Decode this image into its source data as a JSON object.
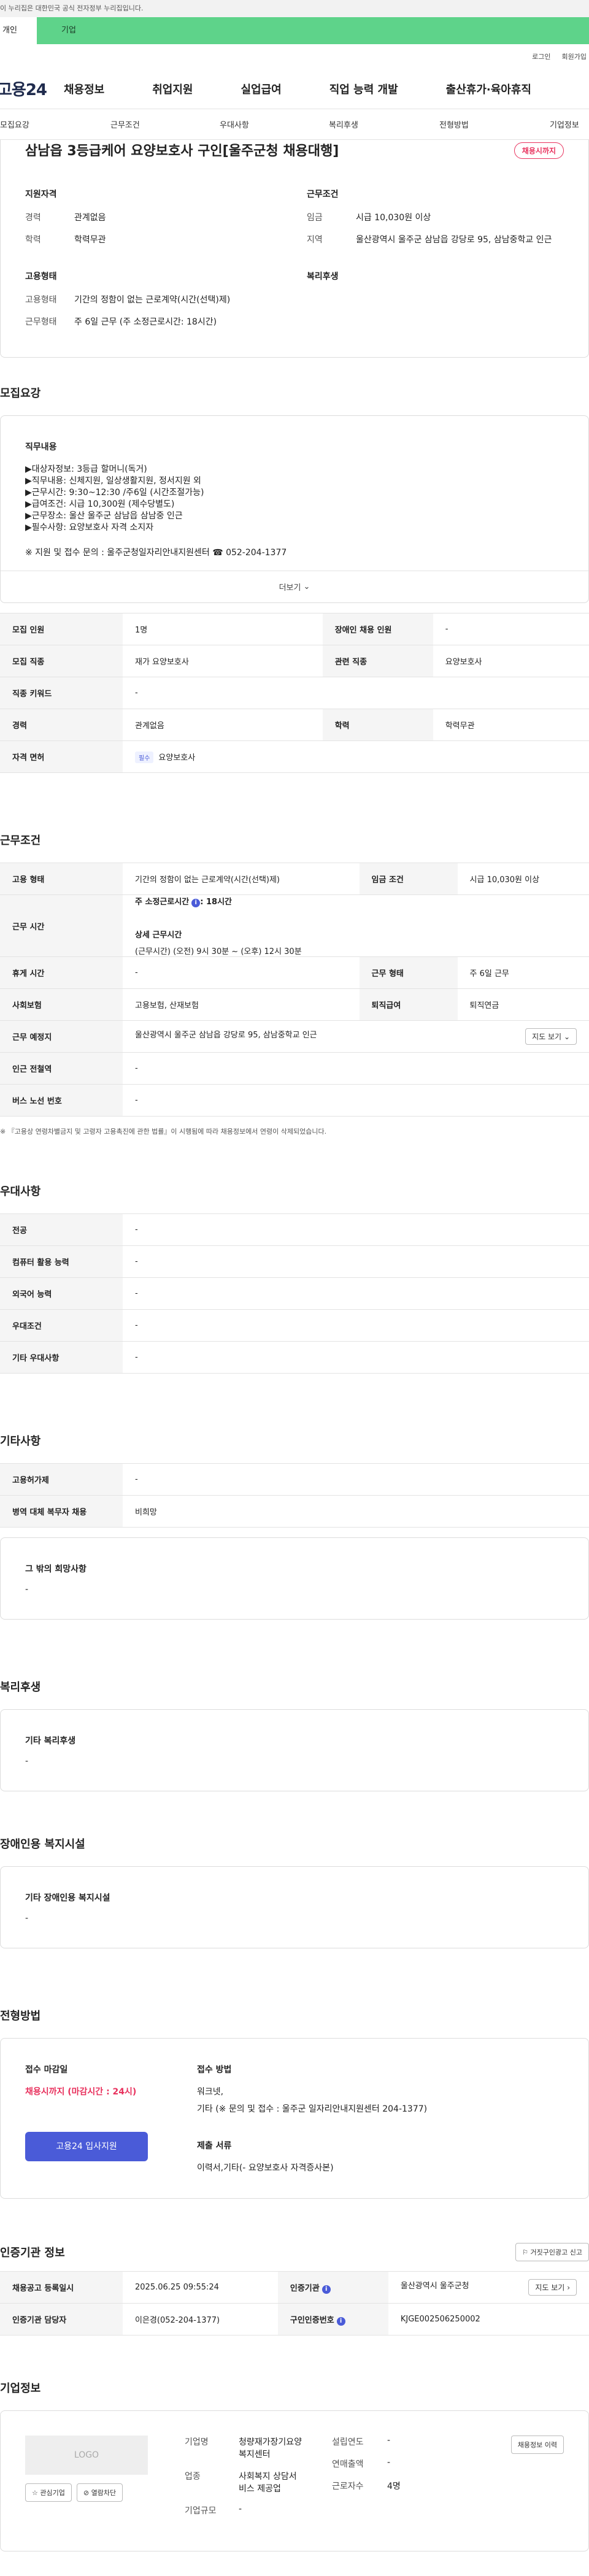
{
  "gov_banner": "이 누리집은 대한민국 공식 전자정부 누리집입니다.",
  "user_type": {
    "person": "개인",
    "corp": "기업"
  },
  "util": {
    "login": "로그인",
    "join": "회원가입"
  },
  "gnb": {
    "logo": "고용24",
    "menu": [
      "채용정보",
      "취업지원",
      "실업급여",
      "직업 능력 개발",
      "출산휴가·육아휴직"
    ]
  },
  "tabs": [
    "모집요강",
    "근무조건",
    "우대사항",
    "복리후생",
    "전형방법",
    "기업정보"
  ],
  "header": {
    "title": "삼남읍 3등급케어 요양보호사 구인[울주군청 채용대행]",
    "badge": "채용시까지",
    "qual_title": "지원자격",
    "cond_title": "근무조건",
    "career_k": "경력",
    "career_v": "관계없음",
    "edu_k": "학력",
    "edu_v": "학력무관",
    "wage_k": "임금",
    "wage_v": "시급 10,030원 이상",
    "region_k": "지역",
    "region_v": "울산광역시 울주군 삼남읍 강당로 95, 삼남중학교 인근",
    "emp_title": "고용형태",
    "welfare_title": "복리후생",
    "emptype_k": "고용형태",
    "emptype_v": "기간의 정함이 없는 근로계약(시간(선택)제)",
    "worktype_k": "근무형태",
    "worktype_v": "주 6일 근무 (주 소정근로시간: 18시간)"
  },
  "recruit": {
    "title": "모집요강",
    "duty_title": "직무내용",
    "lines": [
      "▶대상자정보:  3등급 할머니(독거)",
      "▶직무내용: 신체지원, 일상생활지원, 정서지원 외",
      "▶근무시간: 9:30~12:30 /주6일 (시간조절가능)",
      "▶급여조건: 시급 10,300원 (제수당별도)",
      "▶근무장소: 울산 울주군 삼남읍 삼남중 인근",
      "▶필수사항: 요양보호사 자격 소지자"
    ],
    "contact": "※ 지원 및 접수 문의 : 울주군청일자리안내지원센터 ☎ 052-204-1377",
    "more": "더보기",
    "rows": {
      "count_k": "모집 인원",
      "count_v": "1명",
      "disabled_k": "장애인 채용 인원",
      "disabled_v": "-",
      "job_k": "모집 직종",
      "job_v": "재가 요양보호사",
      "rel_k": "관련 직종",
      "rel_v": "요양보호사",
      "kw_k": "직종 키워드",
      "kw_v": "-",
      "career_k": "경력",
      "career_v": "관계없음",
      "edu_k": "학력",
      "edu_v": "학력무관",
      "lic_k": "자격 면허",
      "lic_pill": "필수",
      "lic_v": "요양보호사"
    }
  },
  "work": {
    "title": "근무조건",
    "emp_k": "고용 형태",
    "emp_v": "기간의 정함이 없는 근로계약(시간(선택)제)",
    "wage_k": "임금 조건",
    "wage_v": "시급 10,030원 이상",
    "time_k": "근무 시간",
    "time_weekly": "주 소정근로시간",
    "time_weekly_v": ": 18시간",
    "time_detail_title": "상세 근무시간",
    "time_detail": "(근무시간) (오전) 9시 30분 ~ (오후) 12시 30분",
    "rest_k": "휴게 시간",
    "rest_v": "-",
    "form_k": "근무 형태",
    "form_v": "주 6일 근무",
    "ins_k": "사회보험",
    "ins_v": "고용보험, 산재보험",
    "sev_k": "퇴직급여",
    "sev_v": "퇴직연금",
    "place_k": "근무 예정지",
    "place_v": "울산광역시 울주군 삼남읍 강당로 95, 삼남중학교 인근",
    "map_btn": "지도 보기",
    "subway_k": "인근 전철역",
    "subway_v": "-",
    "bus_k": "버스 노선 번호",
    "bus_v": "-",
    "note": "※ 『고용상 연령차별금지 및 고령자 고용촉진에 관한 법률』이 시행됨에 따라 채용정보에서 연령이 삭제되었습니다."
  },
  "pref": {
    "title": "우대사항",
    "major_k": "전공",
    "major_v": "-",
    "pc_k": "컴퓨터 활용 능력",
    "pc_v": "-",
    "lang_k": "외국어 능력",
    "lang_v": "-",
    "cond_k": "우대조건",
    "cond_v": "-",
    "etc_k": "기타 우대사항",
    "etc_v": "-"
  },
  "other": {
    "title": "기타사항",
    "permit_k": "고용허가제",
    "permit_v": "-",
    "mil_k": "병역 대체 복무자 채용",
    "mil_v": "비희망",
    "hope_title": "그 밖의 희망사항",
    "hope_v": "-"
  },
  "welfare": {
    "title": "복리후생",
    "sub": "기타 복리후생",
    "v": "-"
  },
  "disabled_fac": {
    "title": "장애인용 복지시설",
    "sub": "기타 장애인용 복지시설",
    "v": "-"
  },
  "screening": {
    "title": "전형방법",
    "deadline_k": "접수 마감일",
    "deadline_v": "채용시까지 (마감시간 : 24시)",
    "method_k": "접수 방법",
    "method_v1": "워크넷,",
    "method_v2": "기타 (※ 문의 및 접수 : 울주군 일자리안내지원센터 204-1377)",
    "docs_k": "제출 서류",
    "docs_v": "이력서,기타(-  요양보호사 자격증사본)",
    "apply_btn": "고용24 입사지원"
  },
  "cert": {
    "title": "인증기관 정보",
    "report_btn": "거짓구인광고 신고",
    "reg_k": "채용공고 등록일시",
    "reg_v": "2025.06.25 09:55:24",
    "org_k": "인증기관",
    "org_v": "울산광역시 울주군청",
    "map_btn": "지도 보기",
    "mgr_k": "인증기관 담당자",
    "mgr_v": "이은경(052-204-1377)",
    "no_k": "구인인증번호",
    "no_v": "KJGE002506250002"
  },
  "company": {
    "title": "기업정보",
    "logo": "LOGO",
    "fav": "관심기업",
    "block": "열람차단",
    "name_k": "기업명",
    "name_v1": "청량재가장기요양",
    "name_v2": "복지센터",
    "ind_k": "업종",
    "ind_v1": "사회복지 상담서",
    "ind_v2": "비스 제공업",
    "size_k": "기업규모",
    "size_v": "-",
    "est_k": "설립연도",
    "est_v": "-",
    "sales_k": "연매출액",
    "sales_v": "-",
    "emp_k": "근로자수",
    "emp_v": "4명",
    "history_btn": "채용정보 이력"
  }
}
